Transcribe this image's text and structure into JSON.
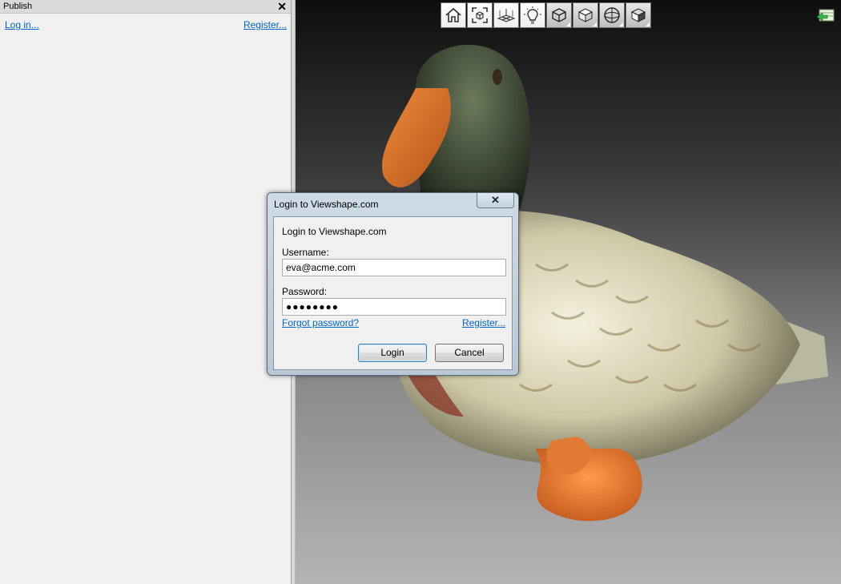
{
  "panel": {
    "title": "Publish",
    "close_glyph": "✕",
    "login_link": "Log in...",
    "register_link": "Register..."
  },
  "toolbar": {
    "buttons": [
      {
        "name": "home-icon"
      },
      {
        "name": "zoom-fit-icon"
      },
      {
        "name": "grid-icon"
      },
      {
        "name": "light-bulb-icon"
      },
      {
        "name": "wireframe-cube-icon"
      },
      {
        "name": "solid-cube-icon"
      },
      {
        "name": "sphere-icon"
      },
      {
        "name": "shaded-cube-icon"
      }
    ]
  },
  "dialog": {
    "title": "Login to Viewshape.com",
    "close_glyph": "✕",
    "heading": "Login to Viewshape.com",
    "username_label": "Username:",
    "username_value": "eva@acme.com",
    "password_label": "Password:",
    "password_value": "●●●●●●●●",
    "forgot_link": "Forgot password?",
    "register_link": "Register...",
    "login_button": "Login",
    "cancel_button": "Cancel"
  },
  "colors": {
    "link": "#0066cc",
    "panel_bg": "#f0f0f0",
    "dialog_frame": "#b9c8d6"
  }
}
